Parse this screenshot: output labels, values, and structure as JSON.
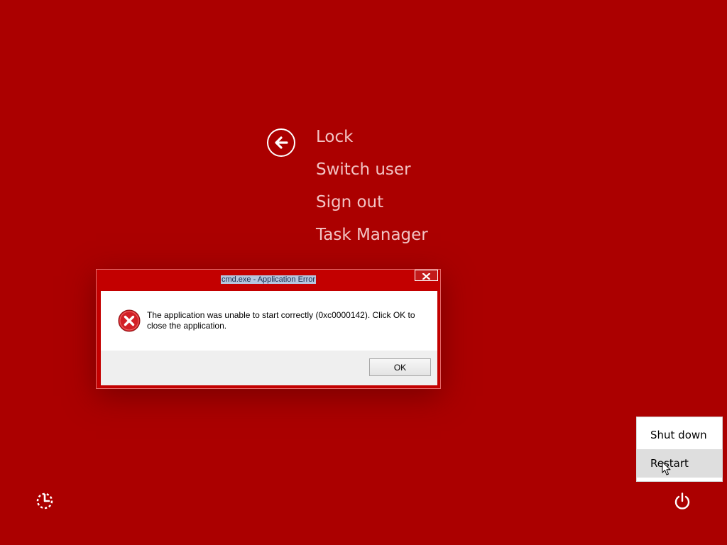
{
  "security_menu": {
    "back_icon": "back-arrow-circle-icon",
    "items": [
      {
        "label": "Lock"
      },
      {
        "label": "Switch user"
      },
      {
        "label": "Sign out"
      },
      {
        "label": "Task Manager"
      }
    ]
  },
  "error_dialog": {
    "title": "cmd.exe - Application Error",
    "close_icon": "close-x-icon",
    "status_icon": "error-x-circle-icon",
    "message": "The application was unable to start correctly (0xc0000142). Click OK to close the application.",
    "ok_label": "OK"
  },
  "power_menu": {
    "items": [
      {
        "label": "Shut down"
      },
      {
        "label": "Restart"
      }
    ]
  },
  "bottom_bar": {
    "ease_of_access_icon": "ease-of-access-icon",
    "power_icon": "power-icon"
  },
  "colors": {
    "background": "#ab0000",
    "menu_text": "#f2c3c3",
    "dialog_frame": "#c30000",
    "error_icon": "#d21f26",
    "hover_item": "#dedede"
  }
}
